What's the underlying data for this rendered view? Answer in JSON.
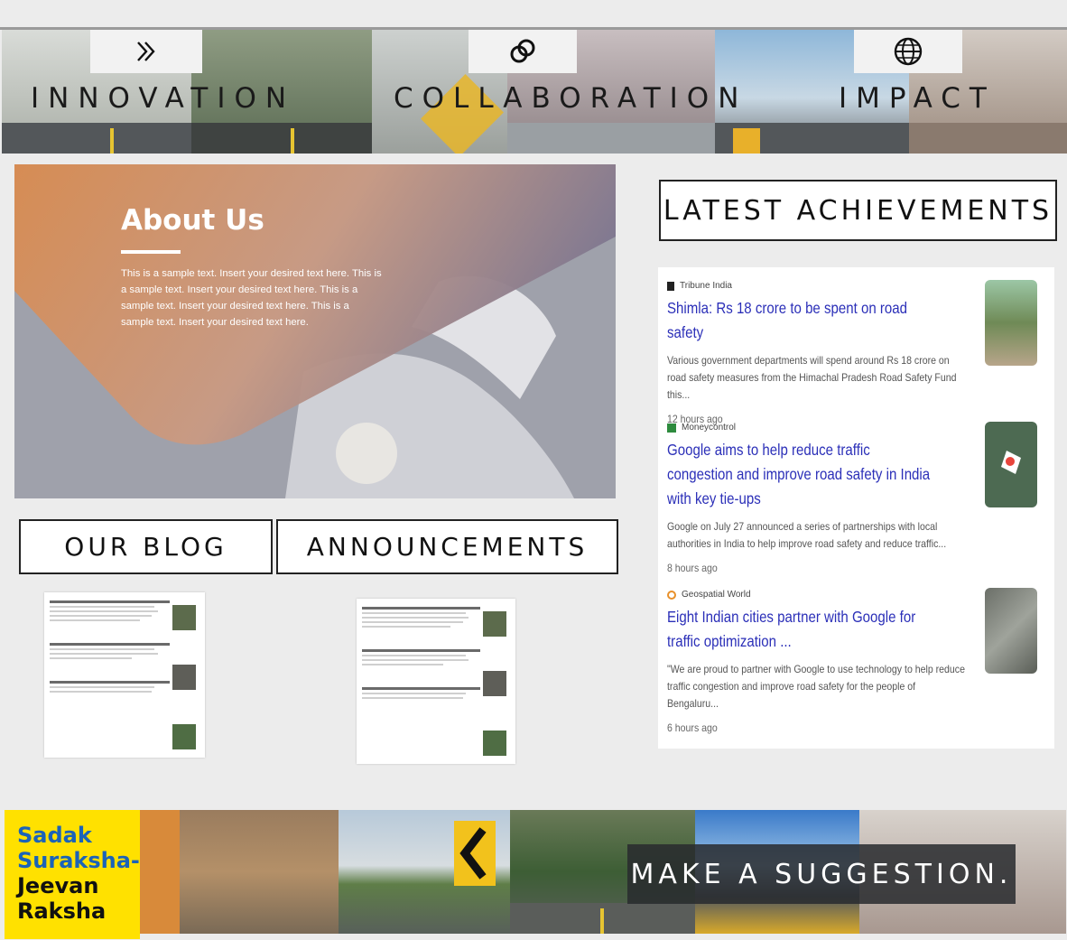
{
  "banner": {
    "items": [
      {
        "label": "INNOVATION",
        "icon": "double-chevron-right-icon"
      },
      {
        "label": "COLLABORATION",
        "icon": "linked-rings-icon"
      },
      {
        "label": "IMPACT",
        "icon": "globe-icon"
      }
    ]
  },
  "about": {
    "title": "About Us",
    "text": "This is a sample text. Insert your desired text here. This is a sample text. Insert your desired text here. This is a sample text. Insert your desired text here. This is a sample text. Insert your desired text here."
  },
  "sections": {
    "blog": "OUR BLOG",
    "announcements": "ANNOUNCEMENTS",
    "achievements": "LATEST ACHIEVEMENTS"
  },
  "news": [
    {
      "source": "Tribune India",
      "headline": "Shimla: Rs 18 crore to be spent on road safety",
      "snippet": "Various government departments will spend around Rs 18 crore on road safety measures from the Himachal Pradesh Road Safety Fund this...",
      "time": "12 hours ago"
    },
    {
      "source": "Moneycontrol",
      "headline": "Google aims to help reduce traffic congestion and improve road safety in India with key tie-ups",
      "snippet": "Google on July 27 announced a series of partnerships with local authorities in India to help improve road safety and reduce traffic...",
      "time": "8 hours ago"
    },
    {
      "source": "Geospatial World",
      "headline": "Eight Indian cities partner with Google for traffic optimization ...",
      "snippet": "\"We are proud to partner with Google to use technology to help reduce traffic congestion and improve road safety for the people of Bengaluru...",
      "time": "6 hours ago"
    }
  ],
  "footer": {
    "brand_lines": [
      "Sadak",
      "Suraksha-",
      "Jeevan",
      "Raksha"
    ],
    "suggestion": "MAKE A SUGGESTION."
  },
  "colors": {
    "brand_yellow": "#ffe100",
    "link_blue": "#2b2fb8",
    "about_orange": "#e0915a"
  }
}
